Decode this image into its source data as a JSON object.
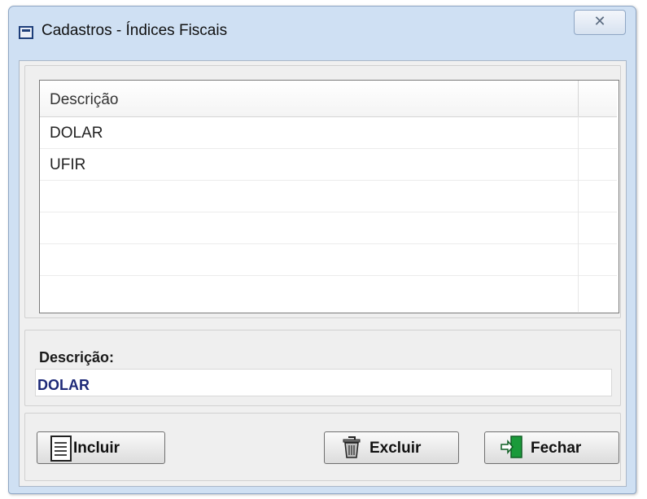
{
  "window": {
    "title": "Cadastros - Índices Fiscais",
    "close_glyph": "✕",
    "icon": "window-icon"
  },
  "grid": {
    "column_header": "Descrição",
    "rows": [
      "DOLAR",
      "UFIR",
      "",
      "",
      "",
      ""
    ]
  },
  "form": {
    "label": "Descrição:",
    "value": "DOLAR"
  },
  "buttons": {
    "incluir": {
      "label": "Incluir",
      "icon": "document-icon"
    },
    "excluir": {
      "label": "Excluir",
      "icon": "trash-icon"
    },
    "fechar": {
      "label": "Fechar",
      "icon": "exit-door-icon"
    }
  },
  "colors": {
    "title_bar": "#cfe0f3",
    "value_text": "#1e2a78",
    "door_icon": "#1a9a3a"
  }
}
